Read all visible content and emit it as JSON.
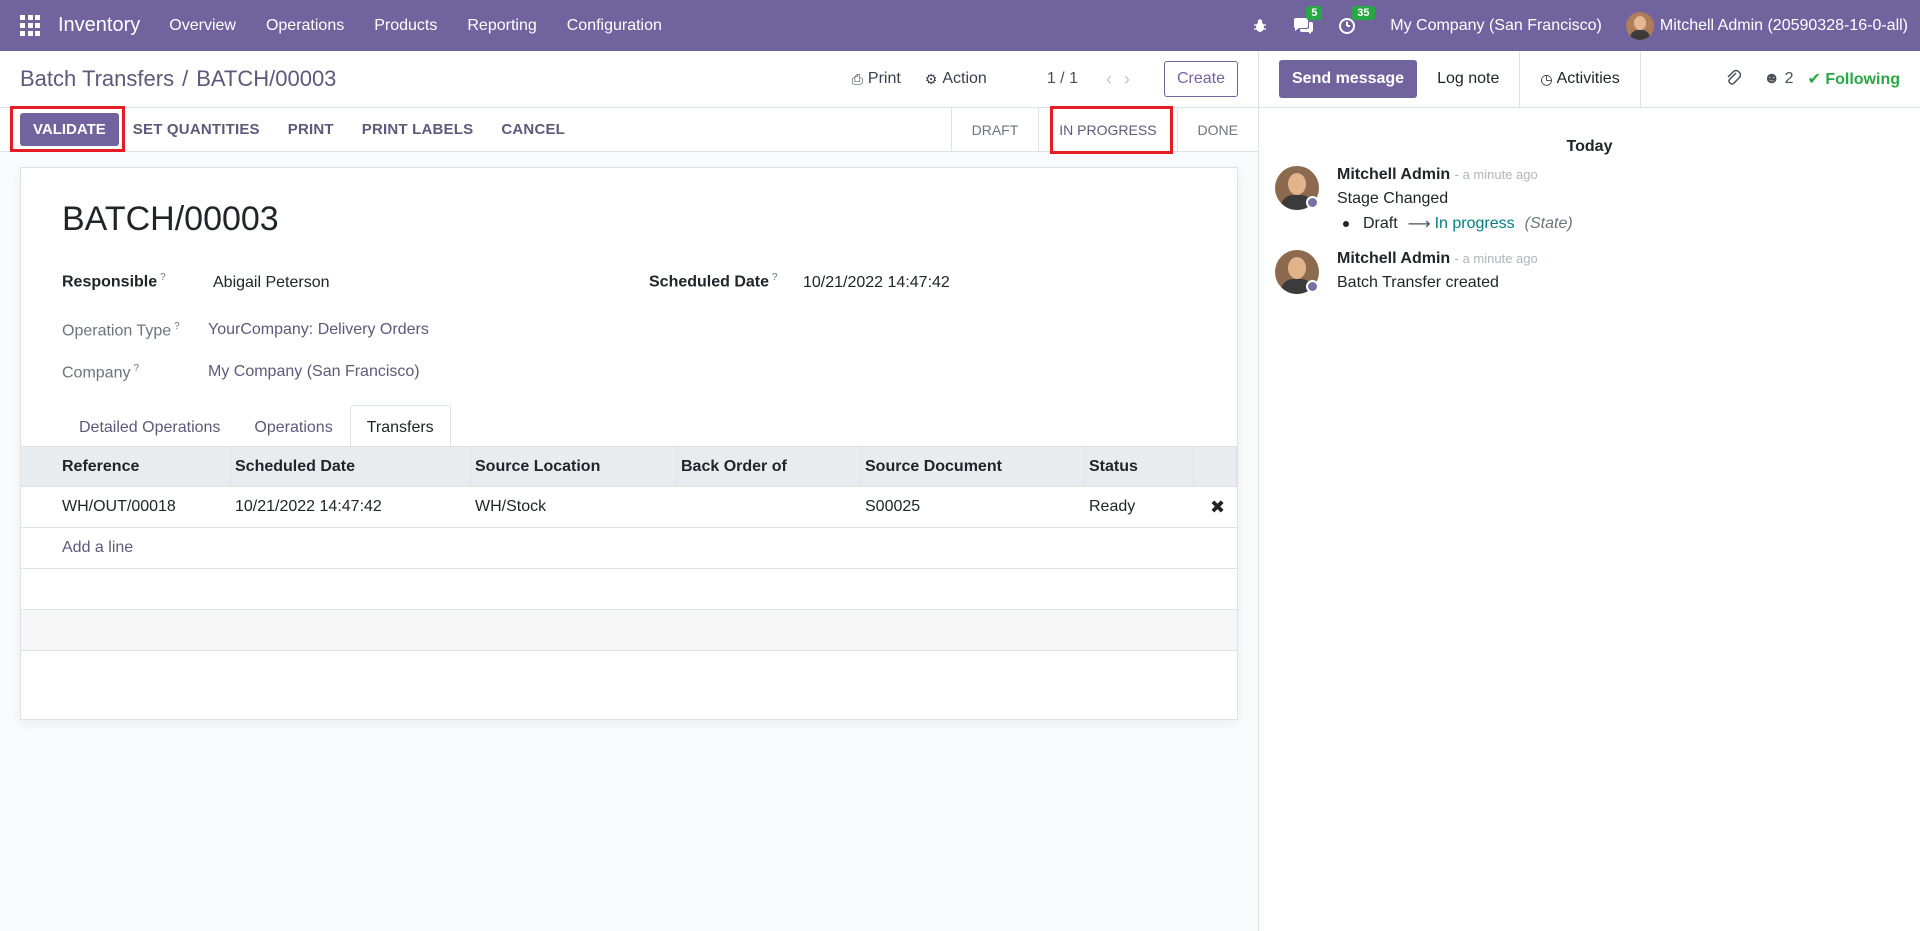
{
  "navbar": {
    "app_name": "Inventory",
    "menu": [
      "Overview",
      "Operations",
      "Products",
      "Reporting",
      "Configuration"
    ],
    "messages_count": "5",
    "activities_count": "35",
    "company": "My Company (San Francisco)",
    "user": "Mitchell Admin (20590328-16-0-all)"
  },
  "control_panel": {
    "breadcrumb_parent": "Batch Transfers",
    "breadcrumb_sep": "/",
    "breadcrumb_current": "BATCH/00003",
    "print_label": "Print",
    "action_label": "Action",
    "pager": "1 / 1",
    "create_label": "Create"
  },
  "statusbar": {
    "buttons": [
      "VALIDATE",
      "SET QUANTITIES",
      "PRINT",
      "PRINT LABELS",
      "CANCEL"
    ],
    "stages": [
      "DRAFT",
      "IN PROGRESS",
      "DONE"
    ],
    "active_stage": "IN PROGRESS"
  },
  "form": {
    "title": "BATCH/00003",
    "responsible_label": "Responsible",
    "responsible_value": "Abigail Peterson",
    "scheduled_label": "Scheduled Date",
    "scheduled_value": "10/21/2022 14:47:42",
    "operation_type_label": "Operation Type",
    "operation_type_value": "YourCompany: Delivery Orders",
    "company_label": "Company",
    "company_value": "My Company (San Francisco)",
    "help_mark": "?",
    "tabs": [
      "Detailed Operations",
      "Operations",
      "Transfers"
    ],
    "active_tab": "Transfers"
  },
  "table": {
    "columns": [
      "Reference",
      "Scheduled Date",
      "Source Location",
      "Back Order of",
      "Source Document",
      "Status"
    ],
    "rows": [
      [
        "WH/OUT/00018",
        "10/21/2022 14:47:42",
        "WH/Stock",
        "",
        "S00025",
        "Ready"
      ]
    ],
    "add_line": "Add a line"
  },
  "chatter": {
    "send_message": "Send message",
    "log_note": "Log note",
    "activities": "Activities",
    "followers_count": "2",
    "following": "Following",
    "date_separator": "Today",
    "messages": [
      {
        "author": "Mitchell Admin",
        "time": "- a minute ago",
        "text": "Stage Changed",
        "old_value": "Draft",
        "new_value": "In progress",
        "field": "(State)"
      },
      {
        "author": "Mitchell Admin",
        "time": "- a minute ago",
        "text": "Batch Transfer created"
      }
    ]
  },
  "colors": {
    "brand": "#71639e",
    "badge": "#28a745",
    "highlight": "#e51c23",
    "link": "#5f587a"
  }
}
